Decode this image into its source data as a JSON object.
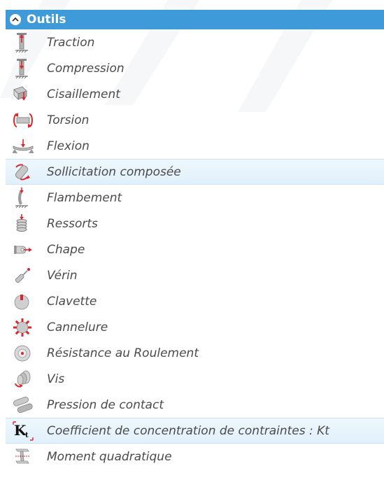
{
  "panel": {
    "title": "Outils",
    "items": [
      {
        "label": "Traction",
        "icon": "traction-icon"
      },
      {
        "label": "Compression",
        "icon": "compression-icon"
      },
      {
        "label": "Cisaillement",
        "icon": "shear-icon"
      },
      {
        "label": "Torsion",
        "icon": "torsion-icon"
      },
      {
        "label": "Flexion",
        "icon": "bending-icon"
      },
      {
        "label": "Sollicitation composée",
        "icon": "combined-load-icon"
      },
      {
        "label": "Flambement",
        "icon": "buckling-icon"
      },
      {
        "label": "Ressorts",
        "icon": "spring-icon"
      },
      {
        "label": "Chape",
        "icon": "clevis-icon"
      },
      {
        "label": "Vérin",
        "icon": "cylinder-icon"
      },
      {
        "label": "Clavette",
        "icon": "key-icon"
      },
      {
        "label": "Cannelure",
        "icon": "spline-icon"
      },
      {
        "label": "Résistance au Roulement",
        "icon": "rolling-resistance-icon"
      },
      {
        "label": "Vis",
        "icon": "screw-icon"
      },
      {
        "label": "Pression de contact",
        "icon": "contact-pressure-icon"
      },
      {
        "label": "Coefficient de concentration de contraintes : Kt",
        "icon": "kt-icon"
      },
      {
        "label": "Moment quadratique",
        "icon": "moment-of-inertia-icon"
      }
    ]
  },
  "colors": {
    "header": "#3e9ad8",
    "selected_row": "#e6f3fc",
    "accent_red": "#e0242b"
  }
}
